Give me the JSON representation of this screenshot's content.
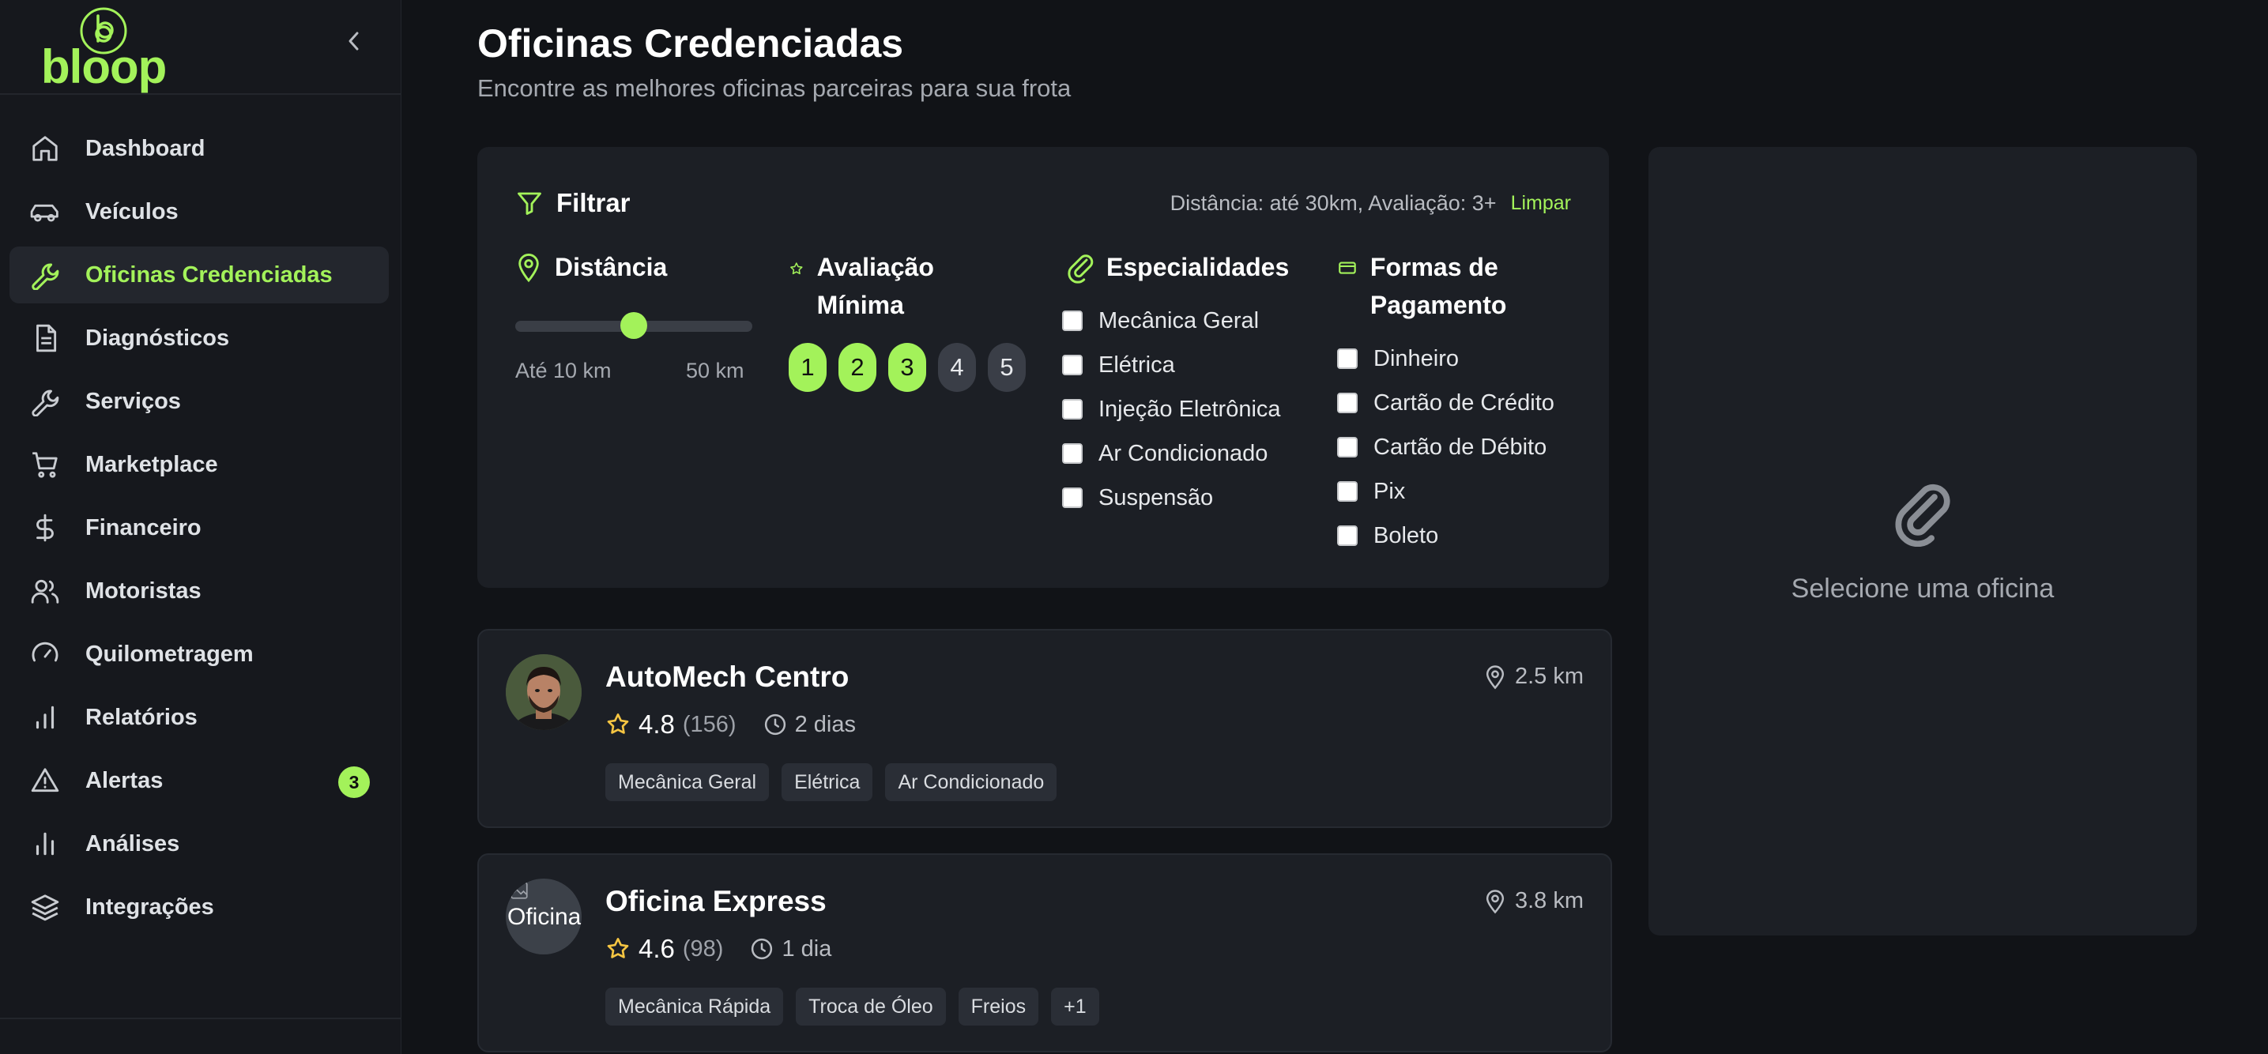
{
  "brand": {
    "name": "bloop",
    "accent": "#a3f25a"
  },
  "sidebar": {
    "items": [
      {
        "label": "Dashboard",
        "icon": "home-icon",
        "active": false
      },
      {
        "label": "Veículos",
        "icon": "car-icon",
        "active": false
      },
      {
        "label": "Oficinas Credenciadas",
        "icon": "wrench-icon",
        "active": true
      },
      {
        "label": "Diagnósticos",
        "icon": "document-icon",
        "active": false
      },
      {
        "label": "Serviços",
        "icon": "wrench-icon",
        "active": false
      },
      {
        "label": "Marketplace",
        "icon": "cart-icon",
        "active": false
      },
      {
        "label": "Financeiro",
        "icon": "dollar-icon",
        "active": false
      },
      {
        "label": "Motoristas",
        "icon": "users-icon",
        "active": false
      },
      {
        "label": "Quilometragem",
        "icon": "gauge-icon",
        "active": false
      },
      {
        "label": "Relatórios",
        "icon": "bar-chart-icon",
        "active": false
      },
      {
        "label": "Alertas",
        "icon": "alert-triangle-icon",
        "active": false,
        "badge": "3"
      },
      {
        "label": "Análises",
        "icon": "bar-chart-icon",
        "active": false
      },
      {
        "label": "Integrações",
        "icon": "layers-icon",
        "active": false
      }
    ]
  },
  "header": {
    "title": "Oficinas Credenciadas",
    "subtitle": "Encontre as melhores oficinas parceiras para sua frota"
  },
  "filters": {
    "title": "Filtrar",
    "summary": "Distância: até 30km, Avaliação: 3+",
    "clear_label": "Limpar",
    "distance": {
      "title": "Distância",
      "min_label": "Até 10 km",
      "max_label": "50 km",
      "value_km": 30,
      "min_km": 10,
      "max_km": 50
    },
    "rating": {
      "title": "Avaliação Mínima",
      "options": [
        "1",
        "2",
        "3",
        "4",
        "5"
      ],
      "selected": 3
    },
    "specialties": {
      "title": "Especialidades",
      "options": [
        "Mecânica Geral",
        "Elétrica",
        "Injeção Eletrônica",
        "Ar Condicionado",
        "Suspensão"
      ]
    },
    "payment": {
      "title": "Formas de Pagamento",
      "options": [
        "Dinheiro",
        "Cartão de Crédito",
        "Cartão de Débito",
        "Pix",
        "Boleto"
      ]
    }
  },
  "shops": [
    {
      "name": "AutoMech Centro",
      "distance": "2.5 km",
      "rating": "4.8",
      "reviews": "(156)",
      "eta": "2 dias",
      "tags": [
        "Mecânica Geral",
        "Elétrica",
        "Ar Condicionado"
      ]
    },
    {
      "name": "Oficina Express",
      "distance": "3.8 km",
      "rating": "4.6",
      "reviews": "(98)",
      "eta": "1 dia",
      "avatar_alt": "Oficina",
      "tags": [
        "Mecânica Rápida",
        "Troca de Óleo",
        "Freios",
        "+1"
      ]
    }
  ],
  "detail": {
    "empty_message": "Selecione uma oficina"
  }
}
